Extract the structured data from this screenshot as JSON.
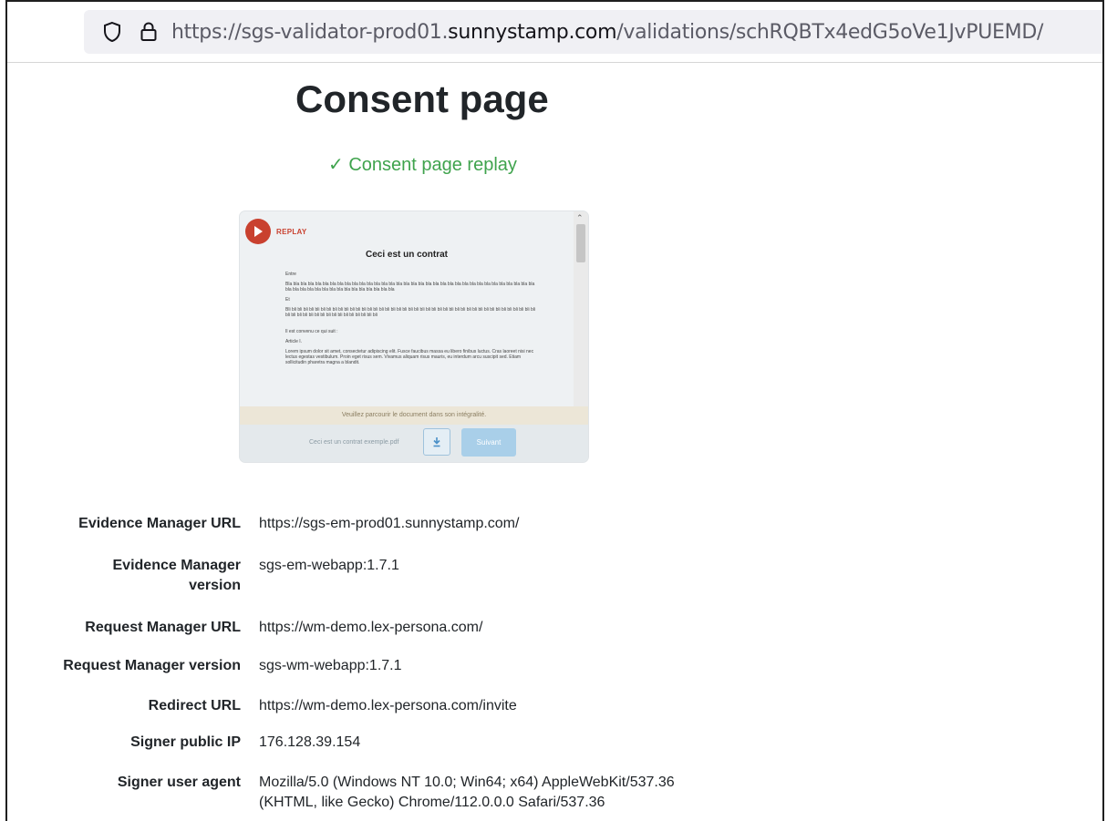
{
  "address_bar": {
    "url_prefix": "https://sgs-validator-prod01.",
    "url_host": "sunnystamp.com",
    "url_path": "/validations/schRQBTx4edG5oVe1JvPUEMD/"
  },
  "page": {
    "title": "Consent page",
    "replay_status": "✓ Consent page replay"
  },
  "preview": {
    "replay_label": "REPLAY",
    "doc_title": "Ceci est un contrat",
    "paragraphs": [
      "Entre",
      "Bla bla bla bla bla bla bla bla bla bla bla bla bla bla bla bla bla bla bla bla bla bla bla bla bla bla bla bla bla bla bla bla bla bla bla bla bla bla bla bla bla bla bla bla bla bla bla bla bla",
      "Et",
      "Bli bli bli bli bli bli bli bli bli bli bli bli bli bli bli bli bli bli bli bli bli bli bli bli bli bli bli bli bli bli bli bli bli bli bli bli bli bli bli bli bli bli bli bli bli bli bli bli bli bli bli bli bli bli bli bli bli bli bli",
      "Il est convenu ce qui suit :",
      "Article I.",
      "Lorem ipsum dolor sit amet, consectetur adipiscing elit. Fusce faucibus massa eu libero finibus luctus. Cras laoreet nisi nec lectus egestas vestibulum. Proin eget risus sem. Vivamus aliquam risus mauris, eu interdum arcu suscipit sed. Etiam sollicitudin pharetra magna a blandit."
    ],
    "notice": "Veuillez parcourir le document dans son intégralité.",
    "file_name": "Ceci est un contrat exemple.pdf",
    "next_label": "Suivant"
  },
  "details": [
    {
      "label": "Evidence Manager URL",
      "value": "https://sgs-em-prod01.sunnystamp.com/"
    },
    {
      "label": "Evidence Manager version",
      "value": "sgs-em-webapp:1.7.1"
    },
    {
      "label": "Request Manager URL",
      "value": "https://wm-demo.lex-persona.com/"
    },
    {
      "label": "Request Manager version",
      "value": "sgs-wm-webapp:1.7.1"
    },
    {
      "label": "Redirect URL",
      "value": "https://wm-demo.lex-persona.com/invite"
    },
    {
      "label": "Signer public IP",
      "value": "176.128.39.154"
    },
    {
      "label": "Signer user agent",
      "value": "Mozilla/5.0 (Windows NT 10.0; Win64; x64) AppleWebKit/537.36 (KHTML, like Gecko) Chrome/112.0.0.0 Safari/537.36"
    }
  ],
  "colors": {
    "success": "#3fa34d",
    "replay_red": "#c9412f",
    "button_blue": "#a9cfe9"
  }
}
